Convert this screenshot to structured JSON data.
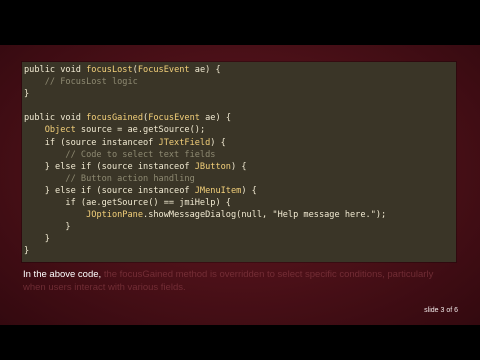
{
  "code": {
    "lines": [
      [
        {
          "t": "public void ",
          "c": "kw"
        },
        {
          "t": "focusLost",
          "c": "ty"
        },
        {
          "t": "(",
          "c": "kw"
        },
        {
          "t": "FocusEvent",
          "c": "ty"
        },
        {
          "t": " ae) {",
          "c": "kw"
        }
      ],
      [
        {
          "t": "    // FocusLost logic",
          "c": "cm"
        }
      ],
      [
        {
          "t": "}",
          "c": "kw"
        }
      ],
      [
        {
          "t": "",
          "c": "kw"
        }
      ],
      [
        {
          "t": "public void ",
          "c": "kw"
        },
        {
          "t": "focusGained",
          "c": "ty"
        },
        {
          "t": "(",
          "c": "kw"
        },
        {
          "t": "FocusEvent",
          "c": "ty"
        },
        {
          "t": " ae) {",
          "c": "kw"
        }
      ],
      [
        {
          "t": "    ",
          "c": "kw"
        },
        {
          "t": "Object",
          "c": "ty"
        },
        {
          "t": " source = ae.",
          "c": "kw"
        },
        {
          "t": "getSource",
          "c": "ca"
        },
        {
          "t": "();",
          "c": "kw"
        }
      ],
      [
        {
          "t": "    if (source instanceof ",
          "c": "kw"
        },
        {
          "t": "JTextField",
          "c": "ty"
        },
        {
          "t": ") {",
          "c": "kw"
        }
      ],
      [
        {
          "t": "        // Code to select text fields",
          "c": "cm"
        }
      ],
      [
        {
          "t": "    } else if (source instanceof ",
          "c": "kw"
        },
        {
          "t": "JButton",
          "c": "ty"
        },
        {
          "t": ") {",
          "c": "kw"
        }
      ],
      [
        {
          "t": "        // Button action handling",
          "c": "cm"
        }
      ],
      [
        {
          "t": "    } else if (source instanceof ",
          "c": "kw"
        },
        {
          "t": "JMenuItem",
          "c": "ty"
        },
        {
          "t": ") {",
          "c": "kw"
        }
      ],
      [
        {
          "t": "        if (ae.",
          "c": "kw"
        },
        {
          "t": "getSource",
          "c": "ca"
        },
        {
          "t": "() == jmiHelp) {",
          "c": "kw"
        }
      ],
      [
        {
          "t": "            ",
          "c": "kw"
        },
        {
          "t": "JOptionPane",
          "c": "ty"
        },
        {
          "t": ".",
          "c": "kw"
        },
        {
          "t": "showMessageDialog",
          "c": "ca"
        },
        {
          "t": "(null, ",
          "c": "kw"
        },
        {
          "t": "\"Help message here.\"",
          "c": "st"
        },
        {
          "t": ");",
          "c": "kw"
        }
      ],
      [
        {
          "t": "        }",
          "c": "kw"
        }
      ],
      [
        {
          "t": "    }",
          "c": "kw"
        }
      ],
      [
        {
          "t": "}",
          "c": "kw"
        }
      ]
    ]
  },
  "caption": {
    "visible": "In the above code, ",
    "faded": "the focusGained method is overridden to select specific conditions, particularly when users interact with various fields."
  },
  "slide_number": "slide 3 of 6"
}
